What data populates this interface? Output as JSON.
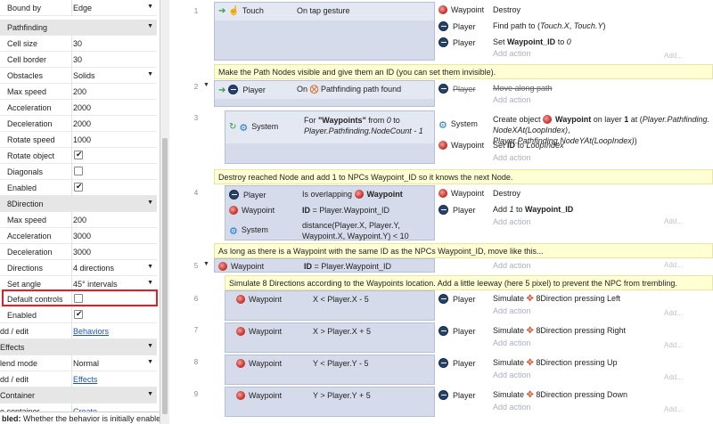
{
  "props": {
    "rows": [
      {
        "name": "Bound by",
        "value": "Edge",
        "kind": "dropdown"
      },
      {
        "name": "Pathfinding",
        "kind": "section"
      },
      {
        "name": "Cell size",
        "value": "30"
      },
      {
        "name": "Cell border",
        "value": "30"
      },
      {
        "name": "Obstacles",
        "value": "Solids",
        "kind": "dropdown"
      },
      {
        "name": "Max speed",
        "value": "200"
      },
      {
        "name": "Acceleration",
        "value": "2000"
      },
      {
        "name": "Deceleration",
        "value": "2000"
      },
      {
        "name": "Rotate speed",
        "value": "1000"
      },
      {
        "name": "Rotate object",
        "checked": true,
        "kind": "check"
      },
      {
        "name": "Diagonals",
        "checked": false,
        "kind": "check"
      },
      {
        "name": "Enabled",
        "checked": true,
        "kind": "check"
      },
      {
        "name": "8Direction",
        "kind": "section"
      },
      {
        "name": "Max speed",
        "value": "200"
      },
      {
        "name": "Acceleration",
        "value": "3000"
      },
      {
        "name": "Deceleration",
        "value": "3000"
      },
      {
        "name": "Directions",
        "value": "4 directions",
        "kind": "dropdown"
      },
      {
        "name": "Set angle",
        "value": "45° intervals",
        "kind": "dropdown"
      },
      {
        "name": "Default controls",
        "checked": false,
        "kind": "check"
      },
      {
        "name": "Enabled",
        "checked": true,
        "kind": "check"
      },
      {
        "name": "dd / edit",
        "value": "Behaviors",
        "kind": "link"
      },
      {
        "name": "Effects",
        "kind": "section"
      },
      {
        "name": "lend mode",
        "value": "Normal",
        "kind": "dropdown"
      },
      {
        "name": "dd / edit",
        "value": "Effects",
        "kind": "link"
      },
      {
        "name": "Container",
        "kind": "section"
      },
      {
        "name": "o container",
        "value": "Create",
        "kind": "link"
      }
    ],
    "footer_bold": "bled:",
    "footer_text": " Whether the behavior is initially enabled or"
  },
  "sheet": {
    "add_action": "Add action",
    "add_right": "Add...",
    "events": [
      {
        "num": "1",
        "cond": [
          {
            "obj": "Touch",
            "text": "On tap gesture"
          }
        ],
        "actions": [
          {
            "obj": "Waypoint",
            "text": "Destroy"
          },
          {
            "obj": "Player",
            "text": "Find path to (Touch.X, Touch.Y)"
          },
          {
            "obj": "Player",
            "text": "Set Waypoint_ID to 0"
          }
        ]
      },
      {
        "comment": "Make the Path Nodes visible and give them an ID (you can set them invisible)."
      },
      {
        "num": "2",
        "cond": [
          {
            "obj": "Player",
            "text": "On  Pathfinding path found"
          }
        ],
        "actions": [
          {
            "obj": "Player",
            "text": "Move along path"
          }
        ]
      },
      {
        "num": "3",
        "cond": [
          {
            "obj": "System",
            "text": "For \"Waypoints\" from 0 to Player.Pathfinding.NodeCount - 1"
          }
        ],
        "actions": [
          {
            "obj": "System",
            "text": "Create object Waypoint on layer 1 at (Player.Pathfinding.NodeXAt(LoopIndex), Player.Pathfinding.NodeYAt(LoopIndex))"
          },
          {
            "obj": "Waypoint",
            "text": "Set ID to LoopIndex"
          }
        ]
      },
      {
        "comment": "Destroy reached Node and add 1 to NPCs Waypoint_ID so it knows the next Node."
      },
      {
        "num": "4",
        "cond": [
          {
            "obj": "Player",
            "text": "Is overlapping Waypoint"
          },
          {
            "obj": "Waypoint",
            "text": "ID = Player.Waypoint_ID"
          },
          {
            "obj": "System",
            "text": "distance(Player.X, Player.Y, Waypoint.X, Waypoint.Y) < 10"
          }
        ],
        "actions": [
          {
            "obj": "Waypoint",
            "text": "Destroy"
          },
          {
            "obj": "Player",
            "text": "Add 1 to Waypoint_ID"
          }
        ]
      },
      {
        "comment": "As long as there is a Waypoint with the same ID as the NPCs Waypoint_ID, move like this..."
      },
      {
        "num": "5",
        "cond": [
          {
            "obj": "Waypoint",
            "text": "ID = Player.Waypoint_ID"
          }
        ],
        "actions": []
      },
      {
        "comment": "Simulate 8 Directions according to the Waypoints location. Add a little leeway (here 5 pixel) to prevent the NPC from trembling."
      },
      {
        "num": "6",
        "cond": [
          {
            "obj": "Waypoint",
            "text": "X < Player.X - 5"
          }
        ],
        "actions": [
          {
            "obj": "Player",
            "text": "Simulate 8Direction pressing Left"
          }
        ]
      },
      {
        "num": "7",
        "cond": [
          {
            "obj": "Waypoint",
            "text": "X > Player.X + 5"
          }
        ],
        "actions": [
          {
            "obj": "Player",
            "text": "Simulate 8Direction pressing Right"
          }
        ]
      },
      {
        "num": "8",
        "cond": [
          {
            "obj": "Waypoint",
            "text": "Y < Player.Y - 5"
          }
        ],
        "actions": [
          {
            "obj": "Player",
            "text": "Simulate 8Direction pressing Up"
          }
        ]
      },
      {
        "num": "9",
        "cond": [
          {
            "obj": "Waypoint",
            "text": "Y > Player.Y + 5"
          }
        ],
        "actions": [
          {
            "obj": "Player",
            "text": "Simulate 8Direction pressing Down"
          }
        ]
      }
    ]
  }
}
